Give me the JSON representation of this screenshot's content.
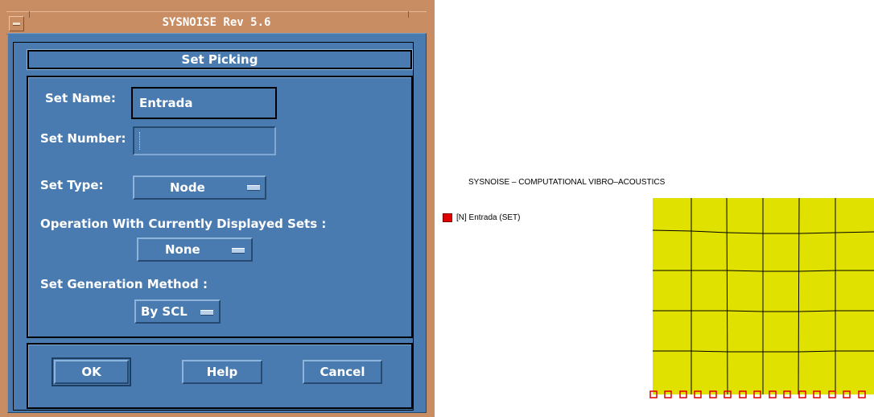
{
  "window": {
    "title": "SYSNOISE Rev 5.6"
  },
  "dialog": {
    "heading": "Set Picking",
    "set_name": {
      "label": "Set Name:",
      "value": "Entrada"
    },
    "set_number": {
      "label": "Set Number:",
      "value": ""
    },
    "set_type": {
      "label": "Set Type:",
      "selected": "Node"
    },
    "operation": {
      "label": "Operation With Currently Displayed Sets :",
      "selected": "None"
    },
    "generation": {
      "label": "Set Generation Method :",
      "selected": "By SCL"
    },
    "buttons": {
      "ok": "OK",
      "help": "Help",
      "cancel": "Cancel"
    }
  },
  "graphics": {
    "title": "SYSNOISE – COMPUTATIONAL VIBRO–ACOUSTICS",
    "legend": {
      "label": "[N] Entrada (SET)",
      "color": "#e10000"
    },
    "mesh_fill": "#e1e100",
    "node_marker_color": "#e10000"
  },
  "colors": {
    "dialog_bg": "#4a7bb0",
    "frame": "#c98d63"
  }
}
